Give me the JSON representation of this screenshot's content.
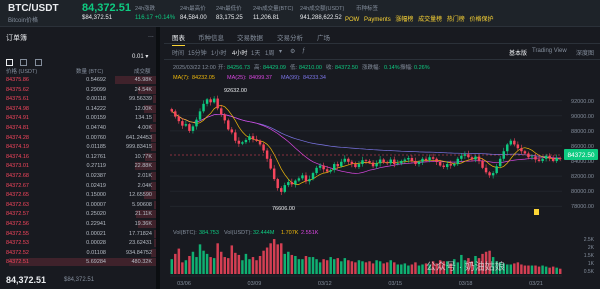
{
  "header": {
    "symbol": "BTC/USDT",
    "sub": "Bitcoin价格",
    "price": "84,372.51",
    "price_usd": "$84,372.51",
    "stats": [
      {
        "label": "24h涨跌",
        "value": "116.17 +0.14%",
        "tone": "green"
      },
      {
        "label": "24h最高价",
        "value": "84,584.00"
      },
      {
        "label": "24h最低价",
        "value": "83,175.25"
      },
      {
        "label": "24h成交量(BTC)",
        "value": "11,206.81"
      },
      {
        "label": "24h成交额(USDT)",
        "value": "941,288,622.52"
      }
    ],
    "tag_label": "币种标签",
    "tags": [
      "POW",
      "Payments",
      "涨幅榜",
      "成交量榜",
      "热门榜",
      "价格保护"
    ]
  },
  "orderbook": {
    "title": "订单簿",
    "more": "...",
    "precision": "0.01 ▾",
    "headers": {
      "price": "价格 (USDT)",
      "amount": "数量 (BTC)",
      "total": "成交额"
    },
    "rows": [
      {
        "price": "84375.86",
        "amount": "0.54692",
        "total": "45.98K",
        "depth": 0.27
      },
      {
        "price": "84375.62",
        "amount": "0.29099",
        "total": "24.54K",
        "depth": 0.12
      },
      {
        "price": "84375.61",
        "amount": "0.00118",
        "total": "99.56339",
        "depth": 0.02
      },
      {
        "price": "84374.98",
        "amount": "0.14222",
        "total": "12.00K",
        "depth": 0.08
      },
      {
        "price": "84374.91",
        "amount": "0.00159",
        "total": "134.15",
        "depth": 0.02
      },
      {
        "price": "84374.81",
        "amount": "0.04740",
        "total": "4.00K",
        "depth": 0.04
      },
      {
        "price": "84374.28",
        "amount": "0.00760",
        "total": "641.24453",
        "depth": 0.03
      },
      {
        "price": "84374.19",
        "amount": "0.01185",
        "total": "999.83415",
        "depth": 0.03
      },
      {
        "price": "84374.16",
        "amount": "0.12761",
        "total": "10.77K",
        "depth": 0.07
      },
      {
        "price": "84373.01",
        "amount": "0.27119",
        "total": "22.88K",
        "depth": 0.14
      },
      {
        "price": "84372.68",
        "amount": "0.02387",
        "total": "2.01K",
        "depth": 0.03
      },
      {
        "price": "84372.67",
        "amount": "0.02419",
        "total": "2.04K",
        "depth": 0.03
      },
      {
        "price": "84372.65",
        "amount": "0.15000",
        "total": "12.65590",
        "depth": 0.08
      },
      {
        "price": "84372.63",
        "amount": "0.00007",
        "total": "5.90608",
        "depth": 0.01
      },
      {
        "price": "84372.57",
        "amount": "0.25020",
        "total": "21.11K",
        "depth": 0.13
      },
      {
        "price": "84372.56",
        "amount": "0.22941",
        "total": "19.36K",
        "depth": 0.12
      },
      {
        "price": "84372.55",
        "amount": "0.00021",
        "total": "17.71824",
        "depth": 0.01
      },
      {
        "price": "84372.53",
        "amount": "0.00028",
        "total": "23.62431",
        "depth": 0.01
      },
      {
        "price": "84372.52",
        "amount": "0.01108",
        "total": "934.84752",
        "depth": 0.03
      },
      {
        "price": "84372.51",
        "amount": "5.69284",
        "total": "480.32K",
        "depth": 0.98
      }
    ],
    "last_price": "84,372.51",
    "last_usd": "$84,372.51"
  },
  "chart_tabs": [
    "图表",
    "币种信息",
    "交易数据",
    "交易分析",
    "广场"
  ],
  "toolbar": {
    "time_label": "时间",
    "intervals": [
      "15分钟",
      "1小时",
      "4小时",
      "1天",
      "1周"
    ],
    "active_interval": "4小时",
    "views": [
      "基本版",
      "Trading View",
      "深度图"
    ]
  },
  "info": {
    "date": "2025/03/22 12:00",
    "open_label": "开:",
    "open": "84256.73",
    "high_label": "高:",
    "high": "84429.09",
    "low_label": "低:",
    "low": "84210.00",
    "close_label": "收:",
    "close": "84372.50",
    "change_label": "涨跌幅:",
    "change": "0.14%",
    "amp_label": "振幅:",
    "amp": "0.26%",
    "ma7_label": "MA(7):",
    "ma7": "84232.05",
    "ma25_label": "MA(25):",
    "ma25": "84099.37",
    "ma99_label": "MA(99):",
    "ma99": "84233.34",
    "vol_label": "Vol(BTC):",
    "vol_btc": "384.753",
    "vol_usdt_label": "Vol(USDT):",
    "vol_usdt": "32.444M",
    "vol_extra": "1.707K",
    "vol_extra2": "2.551K"
  },
  "chart_data": {
    "type": "candlestick",
    "interval": "4h",
    "pair": "BTC/USDT",
    "yaxis": {
      "range": [
        75500,
        94500
      ],
      "ticks": [
        92000,
        90000,
        88000,
        86000,
        84000,
        82000,
        80000,
        78000
      ]
    },
    "xaxis": {
      "labels": [
        "03/06",
        "03/09",
        "03/12",
        "03/15",
        "03/18",
        "03/21"
      ]
    },
    "last_price_label": "84372.50",
    "annotations": {
      "high": "92632.00",
      "low": "76606.00"
    },
    "colors": {
      "up": "#0ecb81",
      "down": "#f6465d",
      "ma7": "#f0b90b",
      "ma25": "#d846e0",
      "ma99": "#7c76e8"
    },
    "series_close": [
      90600,
      89900,
      89300,
      88700,
      88900,
      88000,
      88600,
      89500,
      90600,
      91600,
      92200,
      91800,
      92300,
      91000,
      90200,
      89400,
      88200,
      87800,
      86700,
      86300,
      86500,
      86800,
      87300,
      86900,
      86700,
      86200,
      85400,
      84300,
      83000,
      81600,
      80400,
      79900,
      80800,
      81200,
      80900,
      81400,
      81700,
      82100,
      81300,
      81600,
      82400,
      83100,
      83400,
      82900,
      82600,
      82800,
      83600,
      83300,
      83900,
      84300,
      83900,
      83600,
      83200,
      83600,
      84100,
      84000,
      83800,
      83300,
      83700,
      84200,
      83800,
      83700,
      84200,
      83600,
      83700,
      84000,
      84200,
      84400,
      84000,
      83600,
      83900,
      84300,
      84100,
      84500,
      84300,
      83900,
      83400,
      83200,
      83600,
      83400,
      83600,
      84300,
      84700,
      84900,
      84500,
      84200,
      84600,
      84000,
      83100,
      82500,
      82100,
      82400,
      83300,
      84300,
      85300,
      86200,
      86700,
      86200,
      85700,
      85300,
      85000,
      84500,
      84600,
      84200,
      84000,
      84300,
      84700,
      84400,
      84000,
      84400,
      84372
    ],
    "volume": [
      1.4,
      1.9,
      2.4,
      1.1,
      1.3,
      1.7,
      2.1,
      1.6,
      2.8,
      2.2,
      1.9,
      1.6,
      1.5,
      2.9,
      2.1,
      1.6,
      1.5,
      2.7,
      2.0,
      1.8,
      1.3,
      1.9,
      1.4,
      1.6,
      1.3,
      1.7,
      2.2,
      2.5,
      2.9,
      3.3,
      2.8,
      2.9,
      1.9,
      2.1,
      1.8,
      1.7,
      1.4,
      1.4,
      1.7,
      1.6,
      1.6,
      1.4,
      1.1,
      1.4,
      1.3,
      1.6,
      1.4,
      1.5,
      1.2,
      1.5,
      1.3,
      1.2,
      1.1,
      1.3,
      1.2,
      1.1,
      1.2,
      1.0,
      1.3,
      1.2,
      1.0,
      1.1,
      1.3,
      1.1,
      0.9,
      0.9,
      1.0,
      0.8,
      0.9,
      1.1,
      0.8,
      0.9,
      1.0,
      0.9,
      1.2,
      1.0,
      1.3,
      1.2,
      1.2,
      1.0,
      1.4,
      1.1,
      1.8,
      1.3,
      1.5,
      1.2,
      1.7,
      1.5,
      1.9,
      2.1,
      2.2,
      1.6,
      1.2,
      1.1,
      1.0,
      0.9,
      0.9,
      1.0,
      1.1,
      0.9,
      0.8,
      0.8,
      0.8,
      0.8,
      0.7,
      0.8,
      0.7,
      0.6,
      0.7,
      0.6,
      0.5
    ],
    "volume_axis": {
      "ticks": [
        "2.5K",
        "2K",
        "1.5K",
        "1K",
        "0.5K"
      ]
    }
  },
  "watermark": "公众号 · 奶油姑娘"
}
